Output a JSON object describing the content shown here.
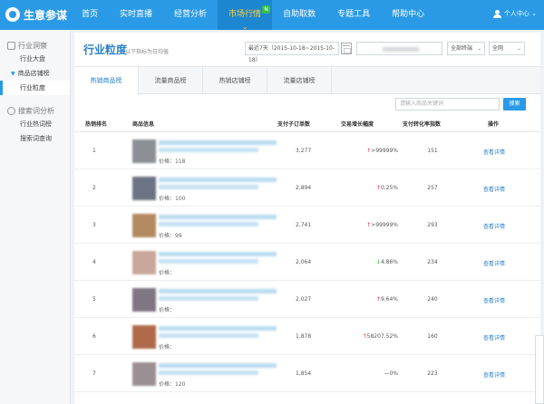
{
  "brand": {
    "name": "生意参谋"
  },
  "nav": [
    {
      "label": "首页",
      "badge": ""
    },
    {
      "label": "实时直播",
      "badge": ""
    },
    {
      "label": "经营分析",
      "badge": ""
    },
    {
      "label": "市场行情",
      "badge": "N"
    },
    {
      "label": "自助取数",
      "badge": ""
    },
    {
      "label": "专题工具",
      "badge": ""
    },
    {
      "label": "帮助中心",
      "badge": ""
    }
  ],
  "user": {
    "label": "个人中心 ⌄"
  },
  "sidebar": {
    "group1": {
      "title": "行业洞察",
      "item1": "行业大盘",
      "sub": "商品店铺榜",
      "active": "行业粒度"
    },
    "group2": {
      "title": "搜索词分析",
      "item1": "行业热词榜",
      "item2": "搜索词查询"
    }
  },
  "header": {
    "title": "行业粒度",
    "subtitle": "以下指标为日均值",
    "date_range": "最近7天（2015-10-18~2015-10-18）",
    "terminal": "全部终端",
    "network": "全网"
  },
  "tabs": [
    "热销商品榜",
    "流量商品榜",
    "热销店铺榜",
    "流量店铺榜"
  ],
  "search": {
    "placeholder": "请输入商品关键词",
    "button": "搜索"
  },
  "table": {
    "headers": [
      "热销排名",
      "商品信息",
      "支付子订单数",
      "交易增长幅度",
      "支付转化率指数",
      "操作"
    ],
    "rows": [
      {
        "rank": "1",
        "price": "价格：118",
        "orders": "3,277",
        "arrow": "↑",
        "growth": ">99999%",
        "conv": "151",
        "action": "查看详情"
      },
      {
        "rank": "2",
        "price": "价格：100",
        "orders": "2,894",
        "arrow": "↑",
        "growth": "0.25%",
        "conv": "257",
        "action": "查看详情"
      },
      {
        "rank": "3",
        "price": "价格：99",
        "orders": "2,741",
        "arrow": "↑",
        "growth": ">99999%",
        "conv": "293",
        "action": "查看详情"
      },
      {
        "rank": "4",
        "price": "价格：",
        "orders": "2,064",
        "arrow": "↓",
        "growth": "4.86%",
        "conv": "234",
        "action": "查看详情"
      },
      {
        "rank": "5",
        "price": "价格：",
        "orders": "2,027",
        "arrow": "↑",
        "growth": "9.64%",
        "conv": "240",
        "action": "查看详情"
      },
      {
        "rank": "6",
        "price": "价格：",
        "orders": "1,878",
        "arrow": "↑",
        "growth": "58207.52%",
        "conv": "160",
        "action": "查看详情"
      },
      {
        "rank": "7",
        "price": "价格：120",
        "orders": "1,854",
        "arrow": "—",
        "growth": "0%",
        "conv": "223",
        "action": "查看详情"
      }
    ]
  },
  "colors": {
    "primary": "#2a9ae6",
    "active_nav_text": "#ffd23a",
    "up": "#ee2233",
    "down": "#22aa22"
  }
}
